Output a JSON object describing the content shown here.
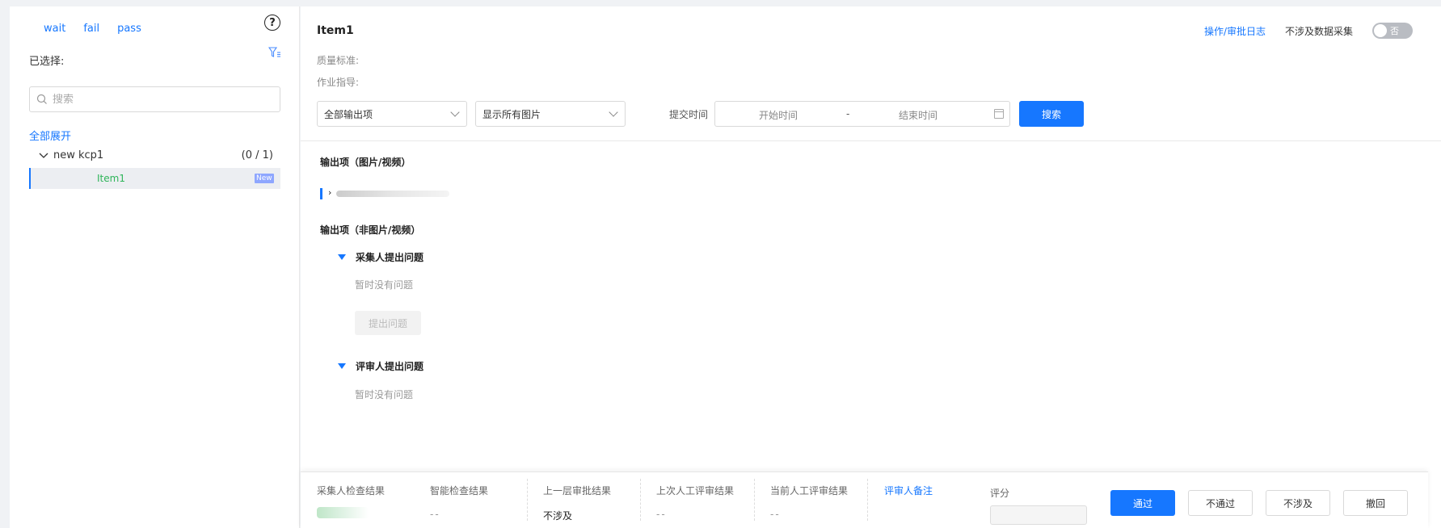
{
  "sidebar": {
    "tabs": [
      "wait",
      "fail",
      "pass"
    ],
    "selected_label": "已选择:",
    "search_placeholder": "搜索",
    "expand_all": "全部展开",
    "tree": {
      "node_label": "new kcp1",
      "node_count": "(0 / 1)",
      "child_label": "Item1",
      "child_badge": "New"
    }
  },
  "main": {
    "title": "Item1",
    "quality_label": "质量标准:",
    "guide_label": "作业指导:",
    "log_link": "操作/审批日志",
    "no_collect_label": "不涉及数据采集",
    "toggle_text": "否",
    "filters": {
      "output_select": "全部输出项",
      "image_select": "显示所有图片",
      "submit_time_label": "提交时间",
      "start_placeholder": "开始时间",
      "dash": "-",
      "end_placeholder": "结束时间",
      "search_button": "搜索"
    },
    "section_media": "输出项（图片/视频）",
    "section_non_media": "输出项（非图片/视频）",
    "collector_issues": "采集人提出问题",
    "collector_no_issue": "暂时没有问题",
    "raise_issue_button": "提出问题",
    "reviewer_issues": "评审人提出问题",
    "reviewer_no_issue": "暂时没有问题"
  },
  "bottom": {
    "collector_result_label": "采集人检查结果",
    "smart_result_label": "智能检查结果",
    "smart_result_value": "--",
    "prev_approval_label": "上一层审批结果",
    "prev_approval_value": "不涉及",
    "last_review_label": "上次人工评审结果",
    "last_review_value": "--",
    "current_review_label": "当前人工评审结果",
    "current_review_value": "--",
    "reviewer_note_label": "评审人备注",
    "score_label": "评分",
    "buttons": {
      "pass": "通过",
      "fail": "不通过",
      "na": "不涉及",
      "revoke": "撤回"
    }
  },
  "colors": {
    "primary": "#1677ff",
    "success_text": "#2fb55a",
    "badge": "#8ea6ff",
    "toggle_off": "#b9bcc2"
  }
}
